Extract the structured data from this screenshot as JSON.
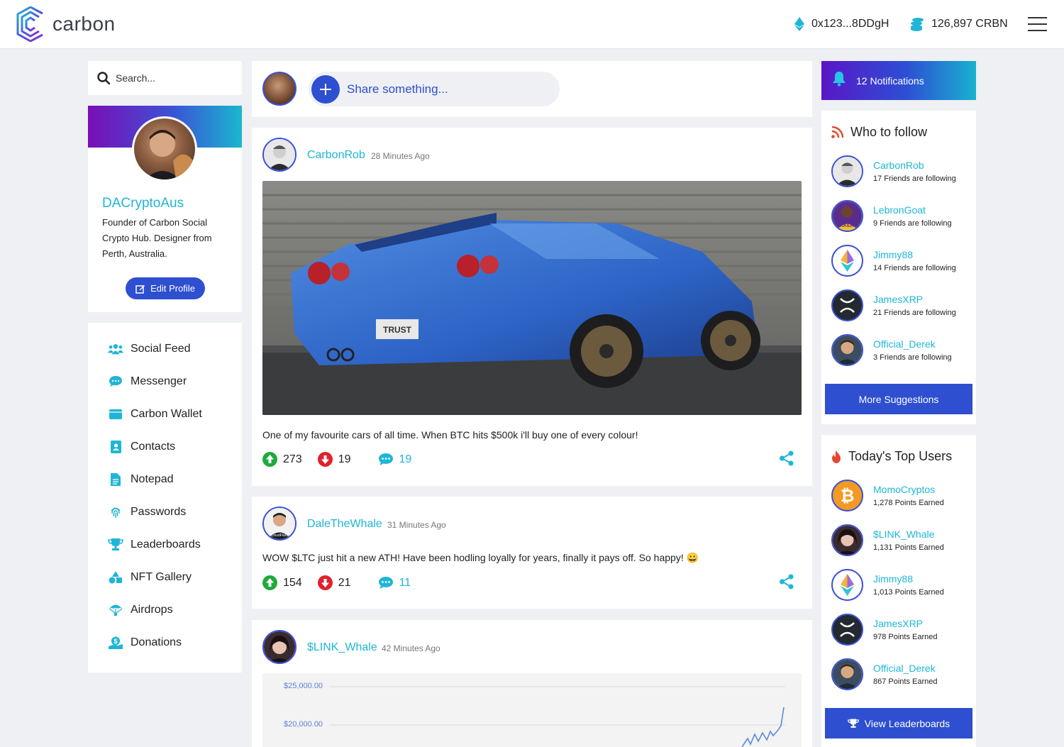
{
  "header": {
    "logo_text": "carbon",
    "wallet_address": "0x123...8DDgH",
    "balance": "126,897 CRBN"
  },
  "search": {
    "placeholder": "Search..."
  },
  "profile": {
    "name": "DACryptoAus",
    "bio": "Founder of Carbon Social Crypto Hub. Designer from Perth, Australia.",
    "edit_label": "Edit Profile"
  },
  "menu": {
    "items": [
      {
        "label": "Social Feed",
        "icon": "users-icon"
      },
      {
        "label": "Messenger",
        "icon": "chat-icon"
      },
      {
        "label": "Carbon Wallet",
        "icon": "wallet-icon"
      },
      {
        "label": "Contacts",
        "icon": "contacts-icon"
      },
      {
        "label": "Notepad",
        "icon": "notepad-icon"
      },
      {
        "label": "Passwords",
        "icon": "fingerprint-icon"
      },
      {
        "label": "Leaderboards",
        "icon": "trophy-icon"
      },
      {
        "label": "NFT Gallery",
        "icon": "shapes-icon"
      },
      {
        "label": "Airdrops",
        "icon": "parachute-icon"
      },
      {
        "label": "Donations",
        "icon": "donation-icon"
      }
    ]
  },
  "composer": {
    "placeholder": "Share something..."
  },
  "posts": [
    {
      "user": "CarbonRob",
      "time": "28 Minutes Ago",
      "text": "One of my favourite cars of all time. When BTC hits $500k i'll buy one of every colour!",
      "upvotes": "273",
      "downvotes": "19",
      "comments": "19"
    },
    {
      "user": "DaleTheWhale",
      "time": "31 Minutes Ago",
      "text": "WOW $LTC just hit a new ATH! Have been hodling loyally for years, finally it pays off. So happy! 😀",
      "upvotes": "154",
      "downvotes": "21",
      "comments": "11"
    },
    {
      "user": "$LINK_Whale",
      "time": "42 Minutes Ago",
      "chart_ticks": [
        "$25,000.00",
        "$20,000.00"
      ]
    }
  ],
  "notifications": {
    "label": "12 Notifications"
  },
  "who_to_follow": {
    "title": "Who to follow",
    "people": [
      {
        "name": "CarbonRob",
        "stat": "17 Friends are following"
      },
      {
        "name": "LebronGoat",
        "stat": "9 Friends are following"
      },
      {
        "name": "Jimmy88",
        "stat": "14 Friends are following"
      },
      {
        "name": "JamesXRP",
        "stat": "21 Friends are following"
      },
      {
        "name": "Official_Derek",
        "stat": "3 Friends are following"
      }
    ],
    "button": "More Suggestions"
  },
  "top_users": {
    "title": "Today's Top Users",
    "people": [
      {
        "name": "MomoCryptos",
        "stat": "1,278 Points Earned"
      },
      {
        "name": "$LINK_Whale",
        "stat": "1,131 Points Earned"
      },
      {
        "name": "Jimmy88",
        "stat": "1,013 Points Earned"
      },
      {
        "name": "JamesXRP",
        "stat": "978 Points Earned"
      },
      {
        "name": "Official_Derek",
        "stat": "867 Points Earned"
      }
    ],
    "button": "View Leaderboards"
  },
  "colors": {
    "accent": "#1fb6d6",
    "primary": "#2e4fcf",
    "upvote": "#1faa3b",
    "downvote": "#e0222b"
  }
}
